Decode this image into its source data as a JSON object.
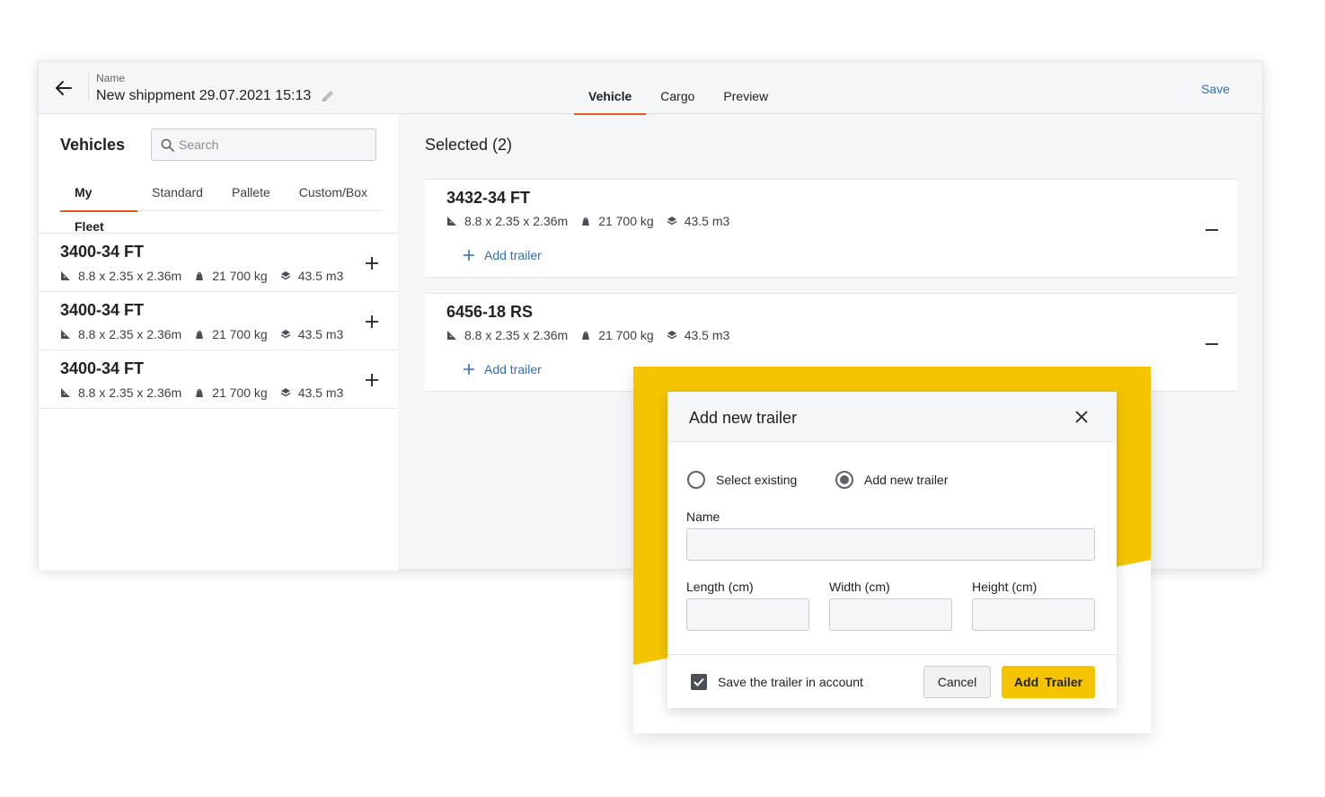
{
  "header": {
    "name_label": "Name",
    "name_value": "New shippment 29.07.2021 15:13",
    "tabs": [
      {
        "label": "Vehicle",
        "active": true
      },
      {
        "label": "Cargo",
        "active": false
      },
      {
        "label": "Preview",
        "active": false
      }
    ],
    "save_label": "Save"
  },
  "left": {
    "title": "Vehicles",
    "search_placeholder": "Search",
    "tabs": [
      {
        "label": "My Fleet",
        "active": true
      },
      {
        "label": "Standard",
        "active": false
      },
      {
        "label": "Pallete",
        "active": false
      },
      {
        "label": "Custom/Box",
        "active": false
      }
    ],
    "fleet": [
      {
        "name": "3400-34 FT",
        "dimensions": "8.8 x 2.35 x 2.36m",
        "weight": "21 700 kg",
        "volume": "43.5 m3"
      },
      {
        "name": "3400-34 FT",
        "dimensions": "8.8 x 2.35 x 2.36m",
        "weight": "21 700 kg",
        "volume": "43.5 m3"
      },
      {
        "name": "3400-34 FT",
        "dimensions": "8.8 x 2.35 x 2.36m",
        "weight": "21 700 kg",
        "volume": "43.5 m3"
      }
    ]
  },
  "right": {
    "title": "Selected (2)",
    "selected": [
      {
        "name": "3432-34 FT",
        "dimensions": "8.8 x 2.35 x 2.36m",
        "weight": "21 700 kg",
        "volume": "43.5 m3",
        "add_trailer_label": "Add trailer"
      },
      {
        "name": "6456-18 RS",
        "dimensions": "8.8 x 2.35 x 2.36m",
        "weight": "21 700 kg",
        "volume": "43.5 m3",
        "add_trailer_label": "Add trailer"
      }
    ]
  },
  "modal": {
    "title": "Add new trailer",
    "radio_existing": "Select existing",
    "radio_new": "Add new trailer",
    "selected_option": "Add new trailer",
    "name_label": "Name",
    "length_label": "Length (cm)",
    "width_label": "Width (cm)",
    "height_label": "Height (cm)",
    "save_checkbox_label": "Save the trailer in account",
    "save_checked": true,
    "cancel_label": "Cancel",
    "add_label": "Add Trailer"
  },
  "colors": {
    "accent_tab": "#e8571e",
    "link": "#2f6fb4",
    "primary_button": "#f5c400",
    "highlight": "#f5c400"
  },
  "icons": [
    "arrow-left-icon",
    "pencil-icon",
    "search-icon",
    "ruler-icon",
    "weight-icon",
    "layers-icon",
    "plus-icon",
    "minus-icon",
    "close-icon",
    "check-icon"
  ]
}
